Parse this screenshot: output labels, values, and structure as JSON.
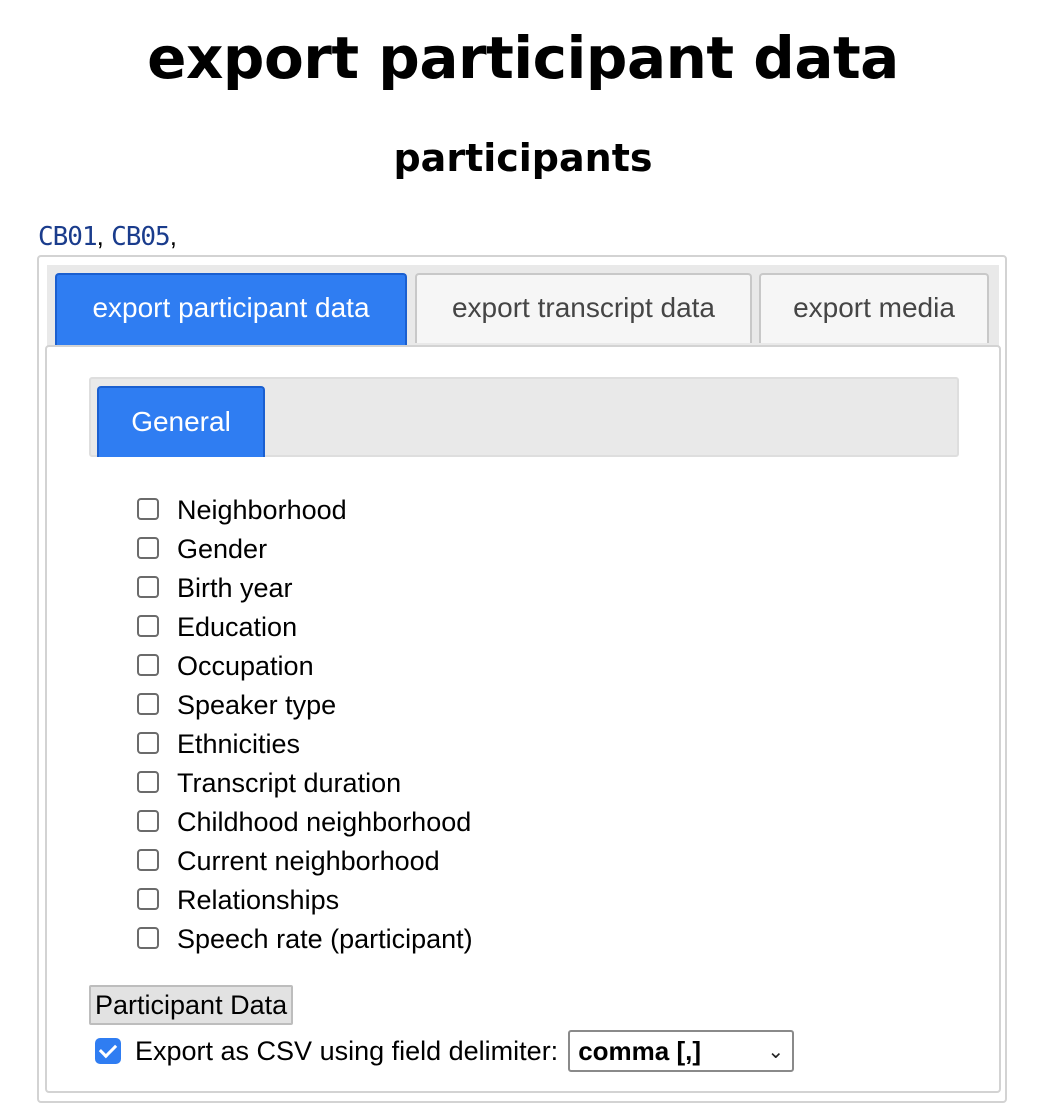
{
  "page": {
    "title": "export participant data",
    "subtitle": "participants"
  },
  "participants": {
    "items": [
      "CB01",
      "CB05"
    ],
    "separator": ", ",
    "trailing": ","
  },
  "tabs": [
    {
      "label": "export participant data",
      "active": true
    },
    {
      "label": "export transcript data",
      "active": false
    },
    {
      "label": "export media",
      "active": false
    }
  ],
  "subtabs": [
    {
      "label": "General",
      "active": true
    }
  ],
  "attributes": [
    {
      "label": "Neighborhood",
      "checked": false
    },
    {
      "label": "Gender",
      "checked": false
    },
    {
      "label": "Birth year",
      "checked": false
    },
    {
      "label": "Education",
      "checked": false
    },
    {
      "label": "Occupation",
      "checked": false
    },
    {
      "label": "Speaker type",
      "checked": false
    },
    {
      "label": "Ethnicities",
      "checked": false
    },
    {
      "label": "Transcript duration",
      "checked": false
    },
    {
      "label": "Childhood neighborhood",
      "checked": false
    },
    {
      "label": "Current neighborhood",
      "checked": false
    },
    {
      "label": "Relationships",
      "checked": false
    },
    {
      "label": "Speech rate (participant)",
      "checked": false
    }
  ],
  "actions": {
    "participant_data_button": "Participant Data",
    "csv_label": "Export as CSV using field delimiter:",
    "csv_checked": true,
    "delimiter_selected": "comma [,]"
  },
  "colors": {
    "accent": "#2f7df2",
    "link": "#1a3c8c",
    "tab_strip": "#e9e9e9"
  },
  "icons": {
    "select_arrow": "chevron-down-icon",
    "csv_check": "checkmark-icon"
  }
}
